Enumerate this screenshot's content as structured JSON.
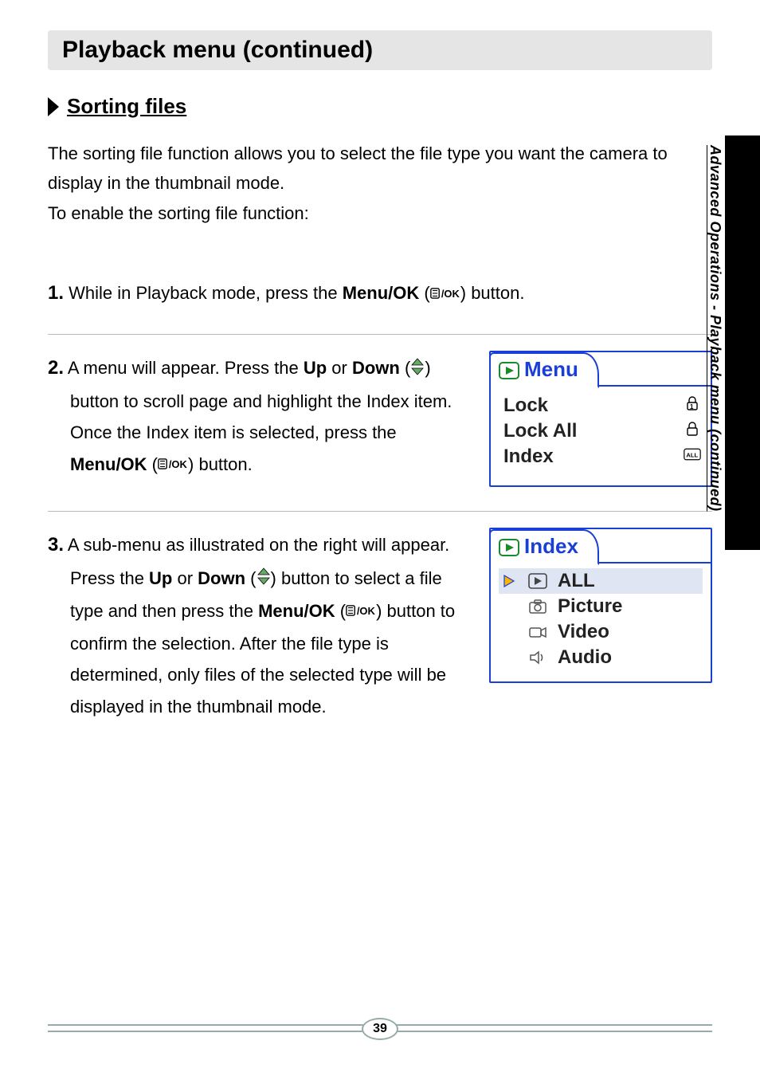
{
  "header": {
    "title": "Playback menu (continued)"
  },
  "subheading": "Sorting files",
  "intro_line1": "The sorting file function allows you to select the file type you want the camera to display in the thumbnail mode.",
  "intro_line2": "To enable the sorting file function:",
  "steps": {
    "s1": {
      "num": "1.",
      "pre": " While in Playback mode, press the ",
      "bold1": "Menu/OK",
      "mid1": " (",
      "post1": ") button."
    },
    "s2": {
      "num": "2.",
      "pre": " A menu will appear. Press the ",
      "bold_up": "Up",
      "or": " or ",
      "bold_down": "Down",
      "mid1": " (",
      "post1": ") ",
      "cont": "button to scroll page and highlight the Index item. Once the Index item is selected, press the ",
      "bold_menuok": "Menu/OK",
      "mid2": " (",
      "post2": ") button."
    },
    "s3": {
      "num": "3.",
      "pre": " A sub-menu as illustrated on the right will appear. ",
      "cont1": "Press the ",
      "bold_up": "Up",
      "or": " or ",
      "bold_down": "Down",
      "mid1": " (",
      "post1": ") button to select a file type and then press the ",
      "bold_menuok": "Menu/OK",
      "mid2": " (",
      "post2": ") button to confirm the selection. After the file type is determined, only files of the selected type will be displayed in the thumbnail mode."
    }
  },
  "fig_menu": {
    "tab": "Menu",
    "rows": [
      "Lock",
      "Lock All",
      "Index"
    ]
  },
  "fig_index": {
    "tab": "Index",
    "rows": [
      "ALL",
      "Picture",
      "Video",
      "Audio"
    ]
  },
  "side_tab": "Advanced Operations - Playback menu (continued)",
  "page_number": "39"
}
